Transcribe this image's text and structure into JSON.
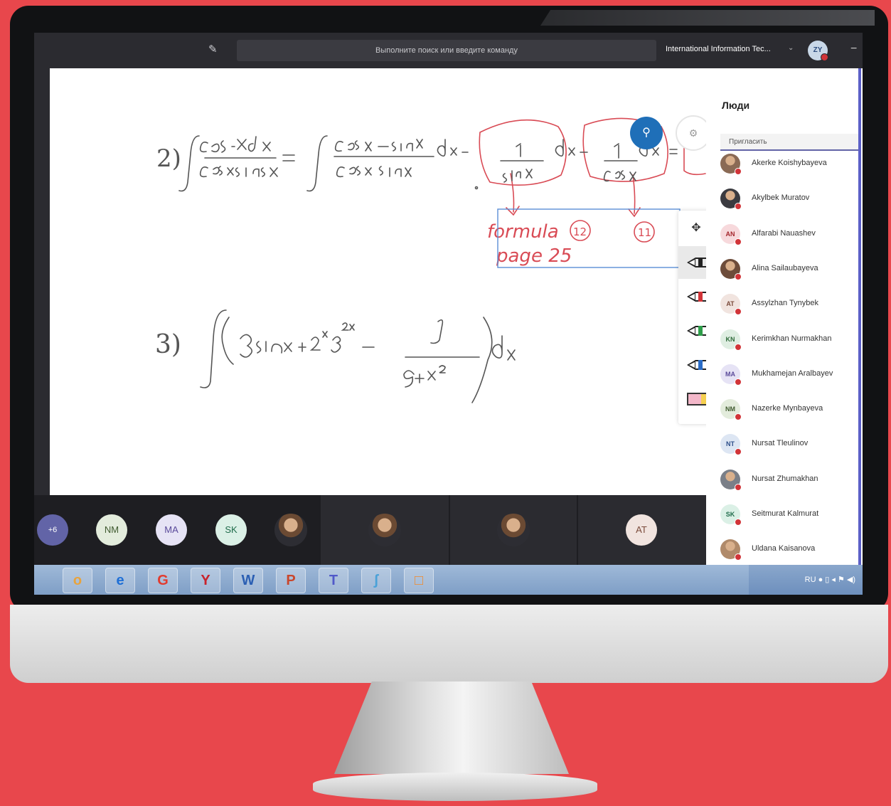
{
  "topbar": {
    "search_placeholder": "Выполните поиск или введите команду",
    "org_name": "International Information Tec...",
    "user_initials": "ZY"
  },
  "whiteboard": {
    "problem2_number": "2)",
    "problem3_number": "3)",
    "annotation_line1": "formula",
    "annotation_num1": "12",
    "annotation_num2": "11",
    "annotation_line2": "page 25"
  },
  "participants_strip": {
    "overflow_label": "+6",
    "avatars": [
      "NM",
      "MA",
      "SK",
      "AT"
    ]
  },
  "people_panel": {
    "title": "Люди",
    "invite_label": "Пригласить",
    "people": [
      {
        "initials": "",
        "name": "Akerke Koishybayeva",
        "photo": true,
        "color": "#8a6a55",
        "text_color": "#fff"
      },
      {
        "initials": "",
        "name": "Akylbek Muratov",
        "photo": true,
        "color": "#3b3b40",
        "text_color": "#fff"
      },
      {
        "initials": "AN",
        "name": "Alfarabi Nauashev",
        "photo": false,
        "color": "#f7d9dc",
        "text_color": "#a4262c"
      },
      {
        "initials": "",
        "name": "Alina Sailaubayeva",
        "photo": true,
        "color": "#6d4c3a",
        "text_color": "#fff"
      },
      {
        "initials": "AT",
        "name": "Assylzhan Tynybek",
        "photo": false,
        "color": "#f1e4df",
        "text_color": "#7a4a3a"
      },
      {
        "initials": "KN",
        "name": "Kerimkhan Nurmakhan",
        "photo": false,
        "color": "#dfeee2",
        "text_color": "#2f6b3a"
      },
      {
        "initials": "MA",
        "name": "Mukhamejan Aralbayev",
        "photo": false,
        "color": "#e6e3f5",
        "text_color": "#5a4a9a"
      },
      {
        "initials": "NM",
        "name": "Nazerke Mynbayeva",
        "photo": false,
        "color": "#e3ecdc",
        "text_color": "#3f5a2f"
      },
      {
        "initials": "NT",
        "name": "Nursat Tleulinov",
        "photo": false,
        "color": "#dde6f3",
        "text_color": "#2e4f8a"
      },
      {
        "initials": "",
        "name": "Nursat Zhumakhan",
        "photo": true,
        "color": "#7a7f88",
        "text_color": "#fff"
      },
      {
        "initials": "SK",
        "name": "Seitmurat Kalmurat",
        "photo": false,
        "color": "#dbf0e6",
        "text_color": "#1f6b4a"
      },
      {
        "initials": "",
        "name": "Uldana Kaisanova",
        "photo": true,
        "color": "#b08a6a",
        "text_color": "#fff"
      }
    ]
  },
  "taskbar": {
    "apps": [
      "o",
      "e",
      "G",
      "Y",
      "W",
      "P",
      "T",
      "ʃ",
      "□"
    ],
    "tray_text": "RU"
  },
  "colors": {
    "background": "#e8474c",
    "teams_dark": "#2b2b30",
    "accent": "#6264a7",
    "fab_blue": "#1f6fb8",
    "status_busy": "#d13438"
  }
}
